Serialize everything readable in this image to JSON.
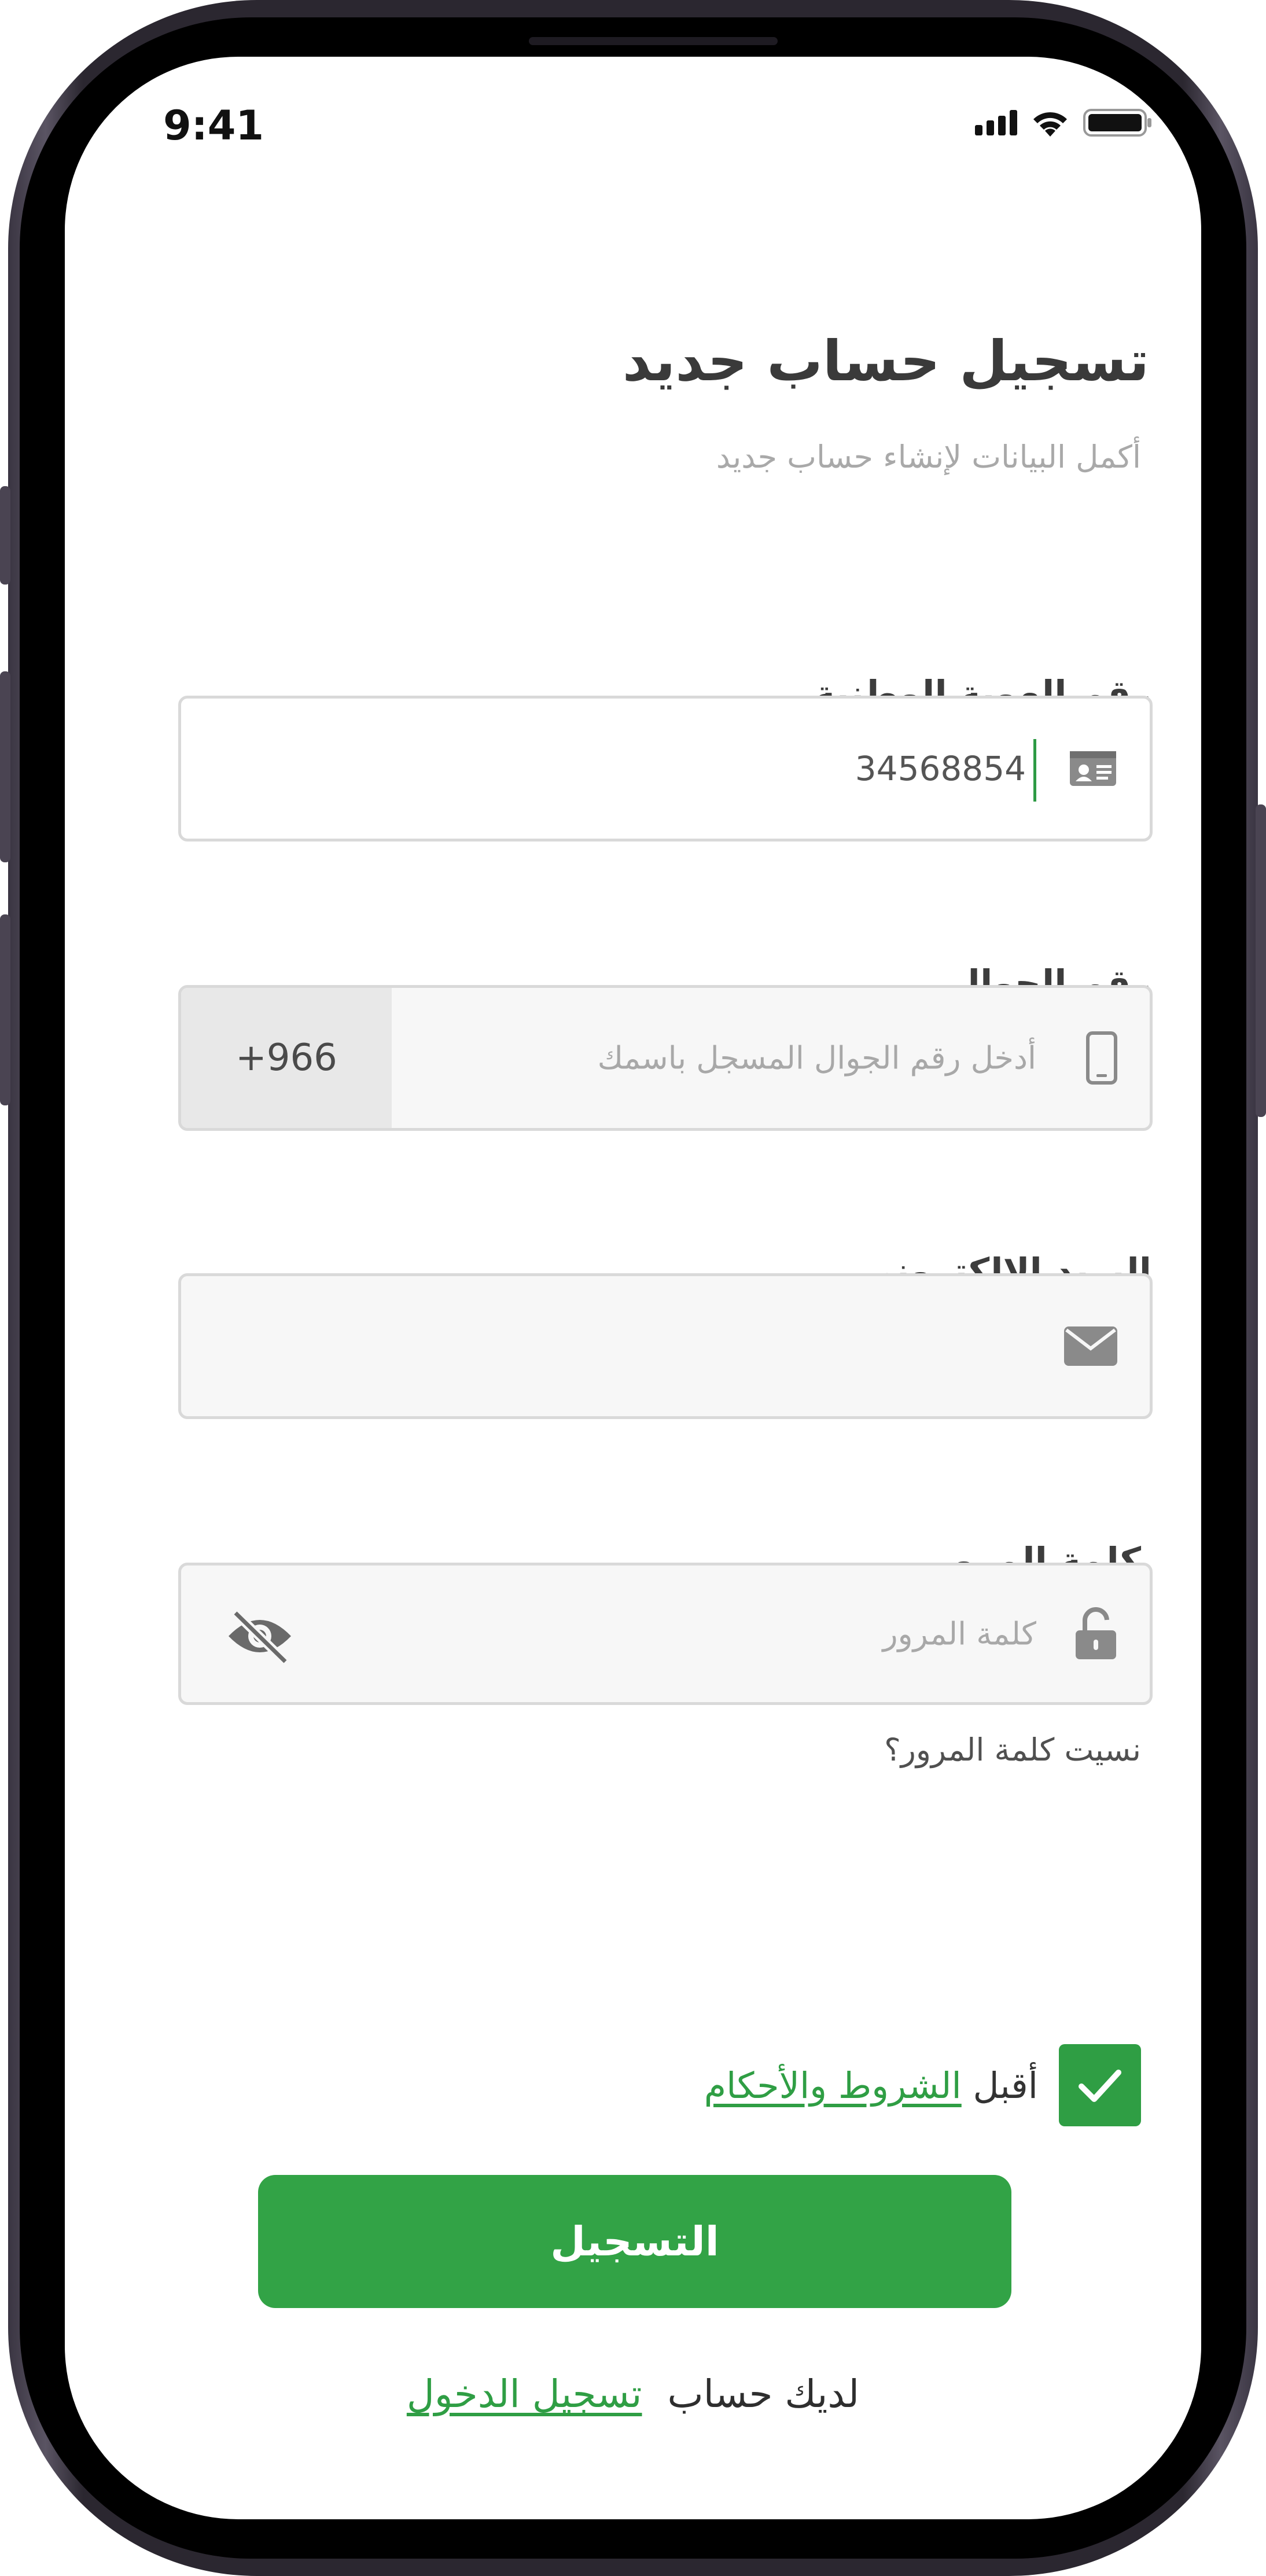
{
  "status_bar": {
    "time": "9:41"
  },
  "header": {
    "title": "تسجيل حساب جديد",
    "subtitle": "أكمل البيانات لإنشاء حساب جديد"
  },
  "form": {
    "national_id": {
      "label": "رقم الهوية الوطنية",
      "value": "34568854",
      "icon": "id-card-icon"
    },
    "mobile": {
      "label": "رقم الجوال",
      "placeholder": "أدخل رقم الجوال المسجل باسمك",
      "prefix": "+966",
      "icon": "phone-icon"
    },
    "email": {
      "label": "البريد الإلكتروني",
      "value": "",
      "icon": "mail-icon"
    },
    "password": {
      "label": "كلمة المرور",
      "placeholder": "كلمة المرور",
      "icon": "lock-icon",
      "toggle_icon": "eye-off-icon"
    },
    "forgot_password": "نسيت كلمة المرور؟"
  },
  "terms": {
    "prefix": "أقبل",
    "link": "الشروط والأحكام",
    "checked": true
  },
  "submit_label": "التسجيل",
  "login": {
    "question": "لديك حساب",
    "link": "تسجيل الدخول"
  },
  "colors": {
    "accent": "#32a346",
    "text": "#3a3a3a",
    "muted": "#a9a9a9",
    "border": "#d9d9d9"
  }
}
